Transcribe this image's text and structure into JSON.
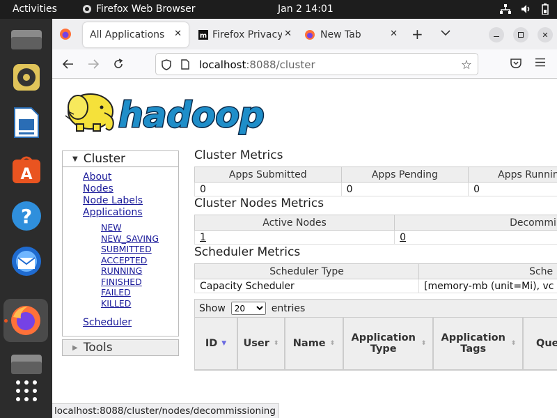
{
  "topbar": {
    "activities": "Activities",
    "app_name": "Firefox Web Browser",
    "clock": "Jan 2  14:01"
  },
  "dock": {
    "items": [
      "files",
      "rhythmbox",
      "libreoffice-writer",
      "app-center",
      "help",
      "thunderbird",
      "firefox",
      "files-2",
      "show-applications"
    ],
    "accent": "#e95420"
  },
  "tabs": [
    {
      "label": "All Applications"
    },
    {
      "label": "Firefox Privacy"
    },
    {
      "label": "New Tab"
    }
  ],
  "url": {
    "host": "localhost",
    "rest": ":8088/cluster"
  },
  "sidebar": {
    "cluster_title": "Cluster",
    "links": [
      "About",
      "Nodes",
      "Node Labels",
      "Applications"
    ],
    "app_states": [
      "NEW",
      "NEW_SAVING",
      "SUBMITTED",
      "ACCEPTED",
      "RUNNING",
      "FINISHED",
      "FAILED",
      "KILLED"
    ],
    "scheduler": "Scheduler",
    "tools_title": "Tools"
  },
  "cluster_metrics": {
    "title": "Cluster Metrics",
    "headers": [
      "Apps Submitted",
      "Apps Pending",
      "Apps Runnin"
    ],
    "values": [
      "0",
      "0",
      "0"
    ]
  },
  "node_metrics": {
    "title": "Cluster Nodes Metrics",
    "headers": [
      "Active Nodes",
      "Decommi"
    ],
    "values": [
      "1",
      "0"
    ]
  },
  "scheduler_metrics": {
    "title": "Scheduler Metrics",
    "headers": [
      "Scheduler Type",
      "Sche"
    ],
    "values": [
      "Capacity Scheduler",
      "[memory-mb (unit=Mi), vc"
    ]
  },
  "apps_table": {
    "show_label": "Show",
    "entries_value": "20",
    "entries_label": "entries",
    "columns": [
      "ID",
      "User",
      "Name",
      "Application Type",
      "Application Tags",
      "Que"
    ]
  },
  "status_bar": "localhost:8088/cluster/nodes/decommissioning"
}
